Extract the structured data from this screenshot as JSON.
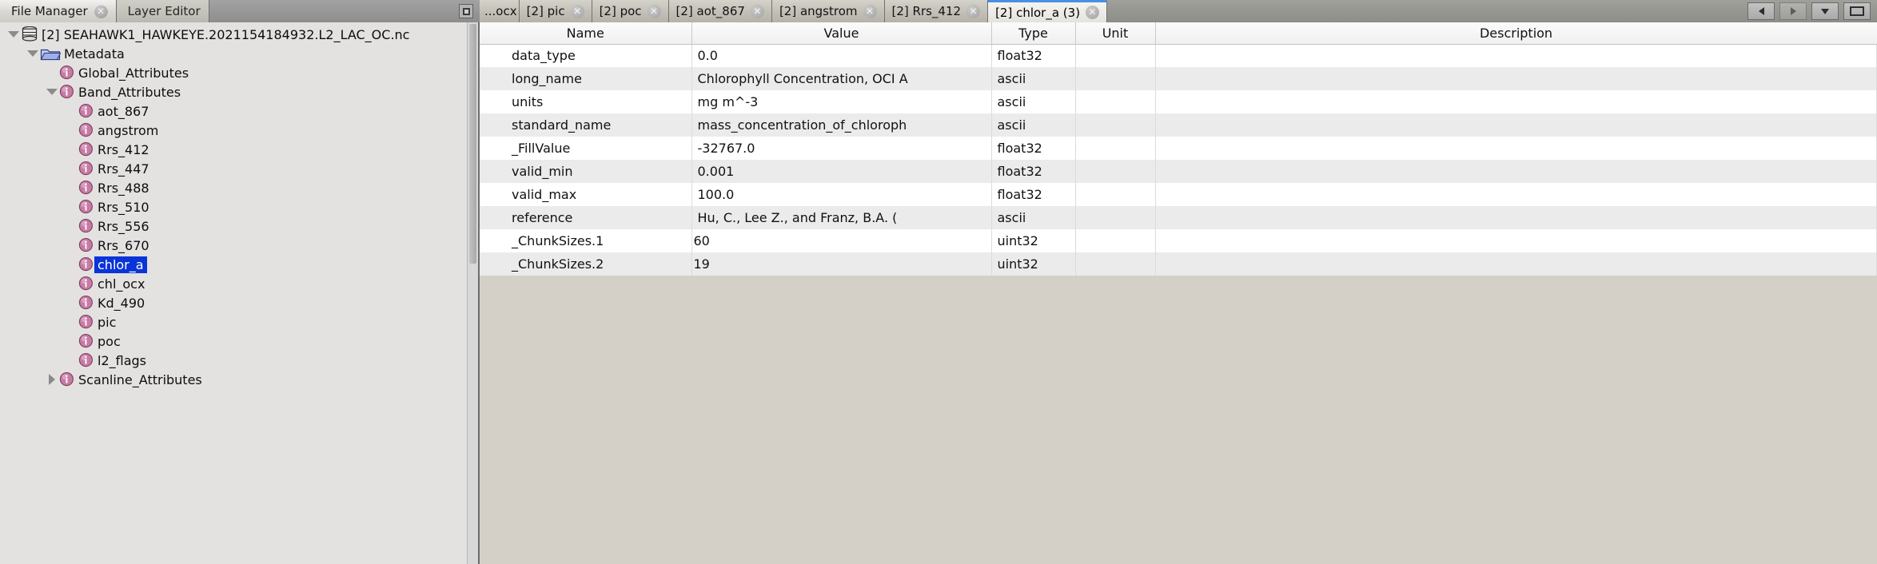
{
  "left_panel": {
    "tabs": [
      {
        "label": "File Manager",
        "active": true,
        "closable": true
      },
      {
        "label": "Layer Editor",
        "active": false,
        "closable": false
      }
    ],
    "float_button_icon": "restore-window-icon",
    "tree": [
      {
        "label": "[2] SEAHAWK1_HAWKEYE.2021154184932.L2_LAC_OC.nc",
        "indent": 0,
        "twisty": "open",
        "icon": "database-icon",
        "selected": false
      },
      {
        "label": "Metadata",
        "indent": 1,
        "twisty": "open",
        "icon": "folder-icon",
        "selected": false
      },
      {
        "label": "Global_Attributes",
        "indent": 2,
        "twisty": "none",
        "icon": "info-icon",
        "selected": false
      },
      {
        "label": "Band_Attributes",
        "indent": 2,
        "twisty": "open",
        "icon": "info-icon",
        "selected": false
      },
      {
        "label": "aot_867",
        "indent": 3,
        "twisty": "none",
        "icon": "info-icon",
        "selected": false
      },
      {
        "label": "angstrom",
        "indent": 3,
        "twisty": "none",
        "icon": "info-icon",
        "selected": false
      },
      {
        "label": "Rrs_412",
        "indent": 3,
        "twisty": "none",
        "icon": "info-icon",
        "selected": false
      },
      {
        "label": "Rrs_447",
        "indent": 3,
        "twisty": "none",
        "icon": "info-icon",
        "selected": false
      },
      {
        "label": "Rrs_488",
        "indent": 3,
        "twisty": "none",
        "icon": "info-icon",
        "selected": false
      },
      {
        "label": "Rrs_510",
        "indent": 3,
        "twisty": "none",
        "icon": "info-icon",
        "selected": false
      },
      {
        "label": "Rrs_556",
        "indent": 3,
        "twisty": "none",
        "icon": "info-icon",
        "selected": false
      },
      {
        "label": "Rrs_670",
        "indent": 3,
        "twisty": "none",
        "icon": "info-icon",
        "selected": false
      },
      {
        "label": "chlor_a",
        "indent": 3,
        "twisty": "none",
        "icon": "info-icon",
        "selected": true
      },
      {
        "label": "chl_ocx",
        "indent": 3,
        "twisty": "none",
        "icon": "info-icon",
        "selected": false
      },
      {
        "label": "Kd_490",
        "indent": 3,
        "twisty": "none",
        "icon": "info-icon",
        "selected": false
      },
      {
        "label": "pic",
        "indent": 3,
        "twisty": "none",
        "icon": "info-icon",
        "selected": false
      },
      {
        "label": "poc",
        "indent": 3,
        "twisty": "none",
        "icon": "info-icon",
        "selected": false
      },
      {
        "label": "l2_flags",
        "indent": 3,
        "twisty": "none",
        "icon": "info-icon",
        "selected": false
      },
      {
        "label": "Scanline_Attributes",
        "indent": 2,
        "twisty": "closed",
        "icon": "info-icon",
        "selected": false
      }
    ]
  },
  "document_tabs": [
    {
      "label": "...ocx",
      "active": false,
      "closable": false,
      "truncated": true
    },
    {
      "label": "[2] pic",
      "active": false,
      "closable": true
    },
    {
      "label": "[2] poc",
      "active": false,
      "closable": true
    },
    {
      "label": "[2] aot_867",
      "active": false,
      "closable": true
    },
    {
      "label": "[2] angstrom",
      "active": false,
      "closable": true
    },
    {
      "label": "[2] Rrs_412",
      "active": false,
      "closable": true
    },
    {
      "label": "[2] chlor_a (3)",
      "active": true,
      "closable": true
    }
  ],
  "tab_nav": {
    "prev_label": "◀",
    "next_label": "▶",
    "list_label": "▼",
    "maximize_label": "□"
  },
  "colors": {
    "accent_tab": "#4a90e2",
    "selection": "#0a34d8",
    "info_icon": "#c77ba4",
    "row_odd": "#ffffff",
    "row_even": "#ebebeb"
  },
  "table": {
    "columns": [
      "Name",
      "Value",
      "Type",
      "Unit",
      "Description"
    ],
    "rows": [
      {
        "name": "data_type",
        "value": "0.0",
        "type": "float32",
        "unit": "",
        "description": ""
      },
      {
        "name": "long_name",
        "value": "Chlorophyll Concentration, OCI A",
        "type": "ascii",
        "unit": "",
        "description": ""
      },
      {
        "name": "units",
        "value": "mg m^-3",
        "type": "ascii",
        "unit": "",
        "description": ""
      },
      {
        "name": "standard_name",
        "value": "mass_concentration_of_chloroph",
        "type": "ascii",
        "unit": "",
        "description": ""
      },
      {
        "name": "_FillValue",
        "value": "-32767.0",
        "type": "float32",
        "unit": "",
        "description": ""
      },
      {
        "name": "valid_min",
        "value": "0.001",
        "type": "float32",
        "unit": "",
        "description": ""
      },
      {
        "name": "valid_max",
        "value": "100.0",
        "type": "float32",
        "unit": "",
        "description": ""
      },
      {
        "name": "reference",
        "value": "Hu, C., Lee Z., and Franz, B.A. (",
        "type": "ascii",
        "unit": "",
        "description": ""
      },
      {
        "name": "_ChunkSizes.1",
        "value": "60",
        "type": "uint32",
        "unit": "",
        "description": ""
      },
      {
        "name": "_ChunkSizes.2",
        "value": "19",
        "type": "uint32",
        "unit": "",
        "description": ""
      }
    ]
  }
}
